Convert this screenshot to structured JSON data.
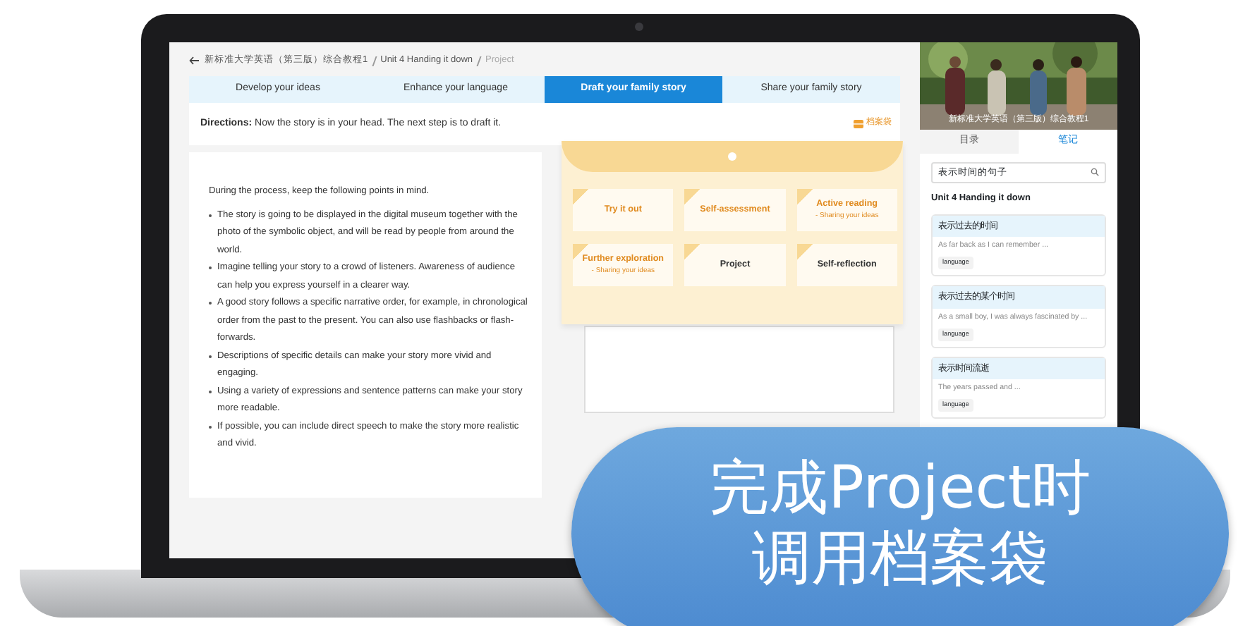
{
  "breadcrumb": [
    {
      "label": "新标准大学英语（第三版）综合教程1",
      "current": false
    },
    {
      "label": "Unit 4 Handing it down",
      "current": false
    },
    {
      "label": "Project",
      "current": true
    }
  ],
  "tabs": [
    {
      "label": "Develop your ideas",
      "selected": false
    },
    {
      "label": "Enhance your language",
      "selected": false
    },
    {
      "label": "Draft your family story",
      "selected": true
    },
    {
      "label": "Share your family story",
      "selected": false
    }
  ],
  "directions": "**Directions:** Now the story is in your head. The next step is to draft it.",
  "portfolio_button": "档案袋",
  "intro": "During the process, keep the following points in mind.",
  "points": [
    "The story is going to be displayed in the digital museum together with the photo of the symbolic object, and will be read by people from around the world.",
    "Imagine telling your story to a crowd of listeners. Awareness of audience can help you express yourself in a clearer way.",
    "A good story follows a specific narrative order, for example, in chronological order from the past to the present. You can also use flashbacks or flash-forwards.",
    "Descriptions of specific details can make your story more vivid and engaging.",
    "Using a variety of expressions and sentence patterns can make your story more readable.",
    "If possible, you can include direct speech to make the story more realistic and vivid."
  ],
  "portfolio_cards": [
    {
      "title": "Try it out",
      "highlighted": true
    },
    {
      "title": "Self-assessment",
      "highlighted": true
    },
    {
      "title": "Active reading",
      "subtitle": "- Sharing your ideas",
      "highlighted": true
    },
    {
      "title": "Further exploration",
      "subtitle": "- Sharing your ideas",
      "highlighted": true
    },
    {
      "title": "Project",
      "highlighted": false
    },
    {
      "title": "Self-reflection",
      "highlighted": false
    }
  ],
  "sidebar": {
    "video_caption": "新标准大学英语（第三版）综合教程1",
    "tabs": [
      {
        "label": "目录",
        "selected": false
      },
      {
        "label": "笔记",
        "selected": true
      }
    ],
    "search": {
      "value": "表示时间的句子"
    },
    "unit_title": "Unit 4 Handing it down",
    "notes": [
      {
        "title": "表示过去的时间",
        "text": "As far back as I can remember ...",
        "tag": "language"
      },
      {
        "title": "表示过去的某个时间",
        "text": "As a small boy, I was always fascinated by ...",
        "tag": "language"
      },
      {
        "title": "表示时间流逝",
        "text": "The years passed and ...",
        "tag": "language"
      }
    ]
  },
  "banner": [
    "完成Project时",
    "调用档案袋"
  ]
}
